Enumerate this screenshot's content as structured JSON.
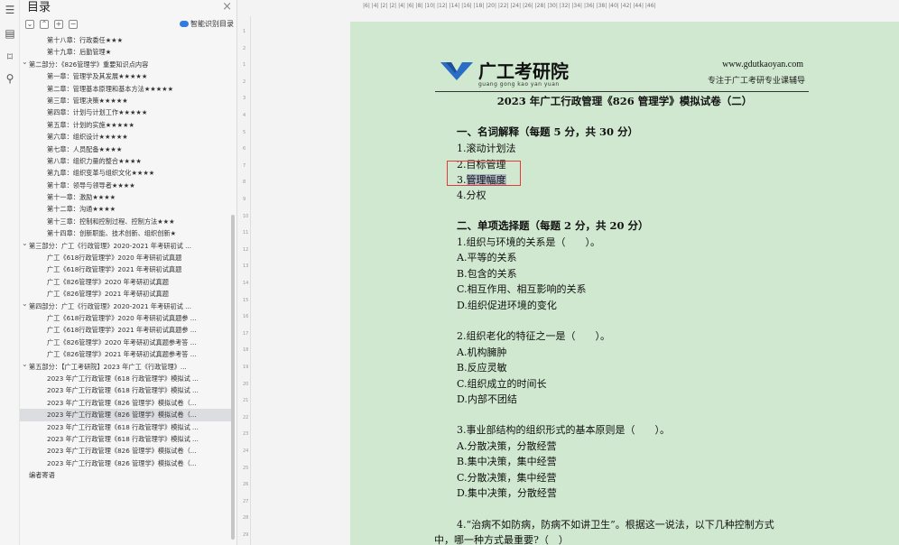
{
  "toc": {
    "title": "目录",
    "close_glyph": "×",
    "tools": [
      "⌄",
      "⌃",
      "+",
      "−"
    ],
    "smart_label": "智能识别目录",
    "items": [
      {
        "level": 1,
        "text": "第十八章：行政委任★★★"
      },
      {
        "level": 1,
        "text": "第十九章：后勤管理★"
      },
      {
        "level": 0,
        "text": "第二部分：《826管理学》重要知识点内容"
      },
      {
        "level": 1,
        "text": "第一章：管理学及其发展★★★★★"
      },
      {
        "level": 1,
        "text": "第二章：管理基本原理和基本方法★★★★★"
      },
      {
        "level": 1,
        "text": "第三章：管理决策★★★★★"
      },
      {
        "level": 1,
        "text": "第四章：计划与计划工作★★★★★"
      },
      {
        "level": 1,
        "text": "第五章：计划的实施★★★★★"
      },
      {
        "level": 1,
        "text": "第六章：组织设计★★★★★"
      },
      {
        "level": 1,
        "text": "第七章：人员配备★★★★"
      },
      {
        "level": 1,
        "text": "第八章：组织力量的整合★★★★"
      },
      {
        "level": 1,
        "text": "第九章：组织变革与组织文化★★★★"
      },
      {
        "level": 1,
        "text": "第十章：领导与领导者★★★★"
      },
      {
        "level": 1,
        "text": "第十一章：激励★★★★"
      },
      {
        "level": 1,
        "text": "第十二章：沟通★★★★"
      },
      {
        "level": 1,
        "text": "第十三章：控制和控制过程、控制方法★★★"
      },
      {
        "level": 1,
        "text": "第十四章：创新职能、技术创新、组织创新★"
      },
      {
        "level": 0,
        "text": "第三部分：广工《行政管理》2020-2021 年考研初试 ..."
      },
      {
        "level": 1,
        "text": "广工《618行政管理学》2020 年考研初试真题"
      },
      {
        "level": 1,
        "text": "广工《618行政管理学》2021 年考研初试真题"
      },
      {
        "level": 1,
        "text": "广工《826管理学》2020 年考研初试真题"
      },
      {
        "level": 1,
        "text": "广工《826管理学》2021 年考研初试真题"
      },
      {
        "level": 0,
        "text": "第四部分：广工《行政管理》2020-2021 年考研初试 ..."
      },
      {
        "level": 1,
        "text": "广工《618行政管理学》2020 年考研初试真题参 ..."
      },
      {
        "level": 1,
        "text": "广工《618行政管理学》2021 年考研初试真题参 ..."
      },
      {
        "level": 1,
        "text": "广工《826管理学》2020 年考研初试真题参考答 ..."
      },
      {
        "level": 1,
        "text": "广工《826管理学》2021 年考研初试真题参考答 ..."
      },
      {
        "level": 0,
        "text": "第五部分：【广工考研院】2023 年广工《行政管理》..."
      },
      {
        "level": 1,
        "text": "2023 年广工行政管理《618 行政管理学》模拟试 ..."
      },
      {
        "level": 1,
        "text": "2023 年广工行政管理《618 行政管理学》模拟试 ..."
      },
      {
        "level": 1,
        "text": "2023 年广工行政管理《826 管理学》模拟试卷（..."
      },
      {
        "level": 1,
        "text": "2023 年广工行政管理《826 管理学》模拟试卷（...",
        "selected": true
      },
      {
        "level": 1,
        "text": "2023 年广工行政管理《618 行政管理学》模拟试 ..."
      },
      {
        "level": 1,
        "text": "2023 年广工行政管理《618 行政管理学》模拟试 ..."
      },
      {
        "level": 1,
        "text": "2023 年广工行政管理《826 管理学》模拟试卷（..."
      },
      {
        "level": 1,
        "text": "2023 年广工行政管理《826 管理学》模拟试卷（..."
      },
      {
        "level": -1,
        "text": "编者寄语"
      }
    ]
  },
  "ruler": {
    "horizontal": "|6| |4| |2| |2| |4| |6| |8| |10| |12| |14| |16| |18| |20| |22| |24| |26| |28| |30| |32| |34| |36| |38| |40| |42| |44| |46|",
    "vertical": [
      "1",
      "2",
      "1",
      "2",
      "3",
      "4",
      "5",
      "6",
      "7",
      "8",
      "9",
      "10",
      "11",
      "12",
      "13",
      "14",
      "15",
      "16",
      "17",
      "18",
      "19",
      "20",
      "21",
      "22",
      "23",
      "24",
      "25",
      "26",
      "27",
      "28",
      "29"
    ]
  },
  "header": {
    "brand": "广工考研院",
    "pinyin": "guang gong kao yan yuan",
    "site": "www.gdutkaoyan.com",
    "slogan": "专注于广工考研专业课辅导"
  },
  "document": {
    "title": "2023 年广工行政管理《826 管理学》模拟试卷（二）",
    "section1": "一、名词解释（每题 5 分，共 30 分）",
    "s1_items": [
      "1.滚动计划法",
      "2.目标管理",
      "3.",
      "管理幅度",
      "4.分权"
    ],
    "section2": "二、单项选择题（每题 2 分，共 20 分）",
    "q1": "1.组织与环境的关系是（　　）。",
    "q1_opts": [
      "A.平等的关系",
      "B.包含的关系",
      "C.相互作用、相互影响的关系",
      "D.组织促进环境的变化"
    ],
    "q2": "2.组织老化的特征之一是（　　）。",
    "q2_opts": [
      "A.机构臃肿",
      "B.反应灵敏",
      "C.组织成立的时间长",
      "D.内部不团结"
    ],
    "q3": "3.事业部结构的组织形式的基本原则是（　　）。",
    "q3_opts": [
      "A.分散决策，分散经营",
      "B.集中决策，集中经营",
      "C.分散决策，集中经营",
      "D.集中决策，分散经营"
    ],
    "q4_line1": "4.“治病不如防病，防病不如讲卫生”。根据这一说法，以下几种控制方式",
    "q4_line2": "中，哪一种方式最重要?（　）"
  }
}
